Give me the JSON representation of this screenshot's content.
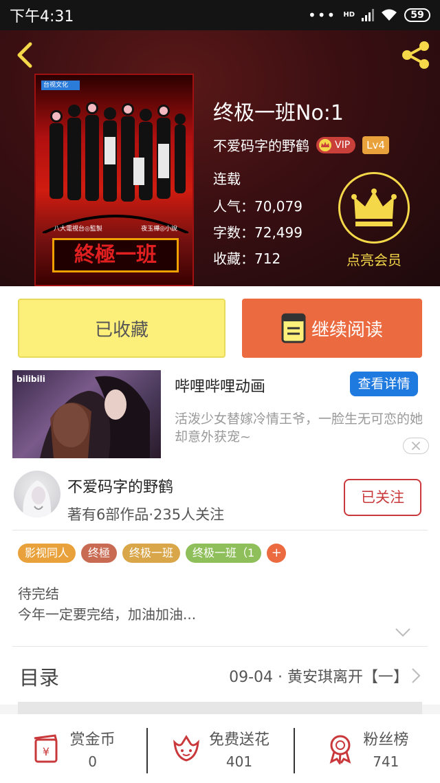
{
  "status_bar": {
    "time": "下午4:31",
    "network": "HD",
    "battery": "59"
  },
  "book": {
    "title": "终极一班No:1",
    "author": "不爱码字的野鹤",
    "vip": "VIP",
    "level": "Lv4",
    "status": "连载",
    "popularity": "人气：70,079",
    "words": "字数：72,499",
    "favorites": "收藏：712",
    "member_label": "点亮会员",
    "cover": {
      "logo": "台视文化",
      "credit_left": "八大電視台◎監製",
      "credit_right": "夜玉樺◎小說",
      "title": "終極一班"
    }
  },
  "actions": {
    "collected": "已收藏",
    "read": "继续阅读"
  },
  "ad": {
    "brand": "bilibili",
    "title": "哔哩哔哩动画",
    "detail": "查看详情",
    "desc": "活泼少女替嫁冷情王爷，一脸生无可恋的她却意外获宠~"
  },
  "author": {
    "name": "不爱码字的野鹤",
    "info": "著有6部作品·235人关注",
    "follow": "已关注"
  },
  "tags": [
    {
      "label": "影视同人",
      "color": "#e9a23b"
    },
    {
      "label": "终極",
      "color": "#c96a52"
    },
    {
      "label": "终极一班",
      "color": "#d9a64a"
    },
    {
      "label": "终极一班（1",
      "color": "#8fbf5a"
    }
  ],
  "tag_add": "+",
  "description": {
    "line1": "待完结",
    "line2": "今年一定要完结，加油加油..."
  },
  "catalog": {
    "label": "目录",
    "latest": "09-04 · 黄安琪离开【一】"
  },
  "bottom": [
    {
      "label": "赏金币",
      "value": "0",
      "icon": "red-envelope-icon"
    },
    {
      "label": "免费送花",
      "value": "401",
      "icon": "flower-icon"
    },
    {
      "label": "粉丝榜",
      "value": "741",
      "icon": "medal-icon"
    }
  ],
  "colors": {
    "accent": "#eb6a40",
    "follow": "#c9393b",
    "crown": "#f4d84a",
    "blue": "#1f7ae0"
  }
}
